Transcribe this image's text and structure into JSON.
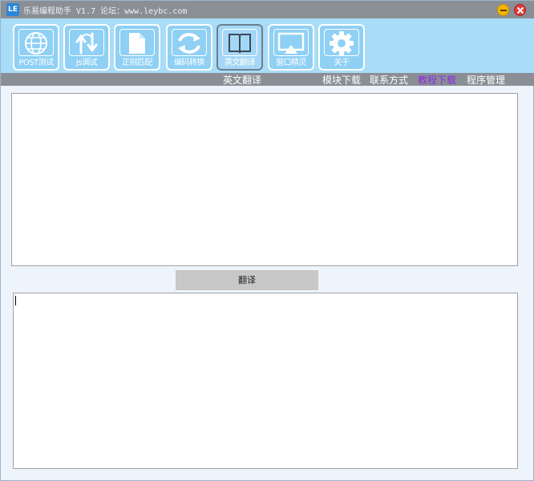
{
  "window": {
    "logo": "LE",
    "title": "乐易编程助手 V1.7 论坛：www.leybc.com"
  },
  "toolbar": {
    "items": [
      {
        "label": "POST测试",
        "icon": "globe-icon"
      },
      {
        "label": "Js调试",
        "icon": "arrows-updown-icon"
      },
      {
        "label": "正则匹配",
        "icon": "document-icon"
      },
      {
        "label": "编码转换",
        "icon": "sync-icon"
      },
      {
        "label": "英文翻译",
        "icon": "book-icon"
      },
      {
        "label": "窗口精灵",
        "icon": "screen-icon"
      },
      {
        "label": "关于",
        "icon": "gear-icon"
      }
    ]
  },
  "menubar": {
    "current": "英文翻译",
    "links": [
      "模块下载",
      "联系方式",
      "教程下载",
      "程序管理"
    ]
  },
  "main": {
    "translate_button": "翻译",
    "input_text": "",
    "output_text": ""
  },
  "colors": {
    "toolbar_bg": "#a9dcf7",
    "menubar_bg": "#8a8f96",
    "highlight_link": "#8a2be2"
  }
}
